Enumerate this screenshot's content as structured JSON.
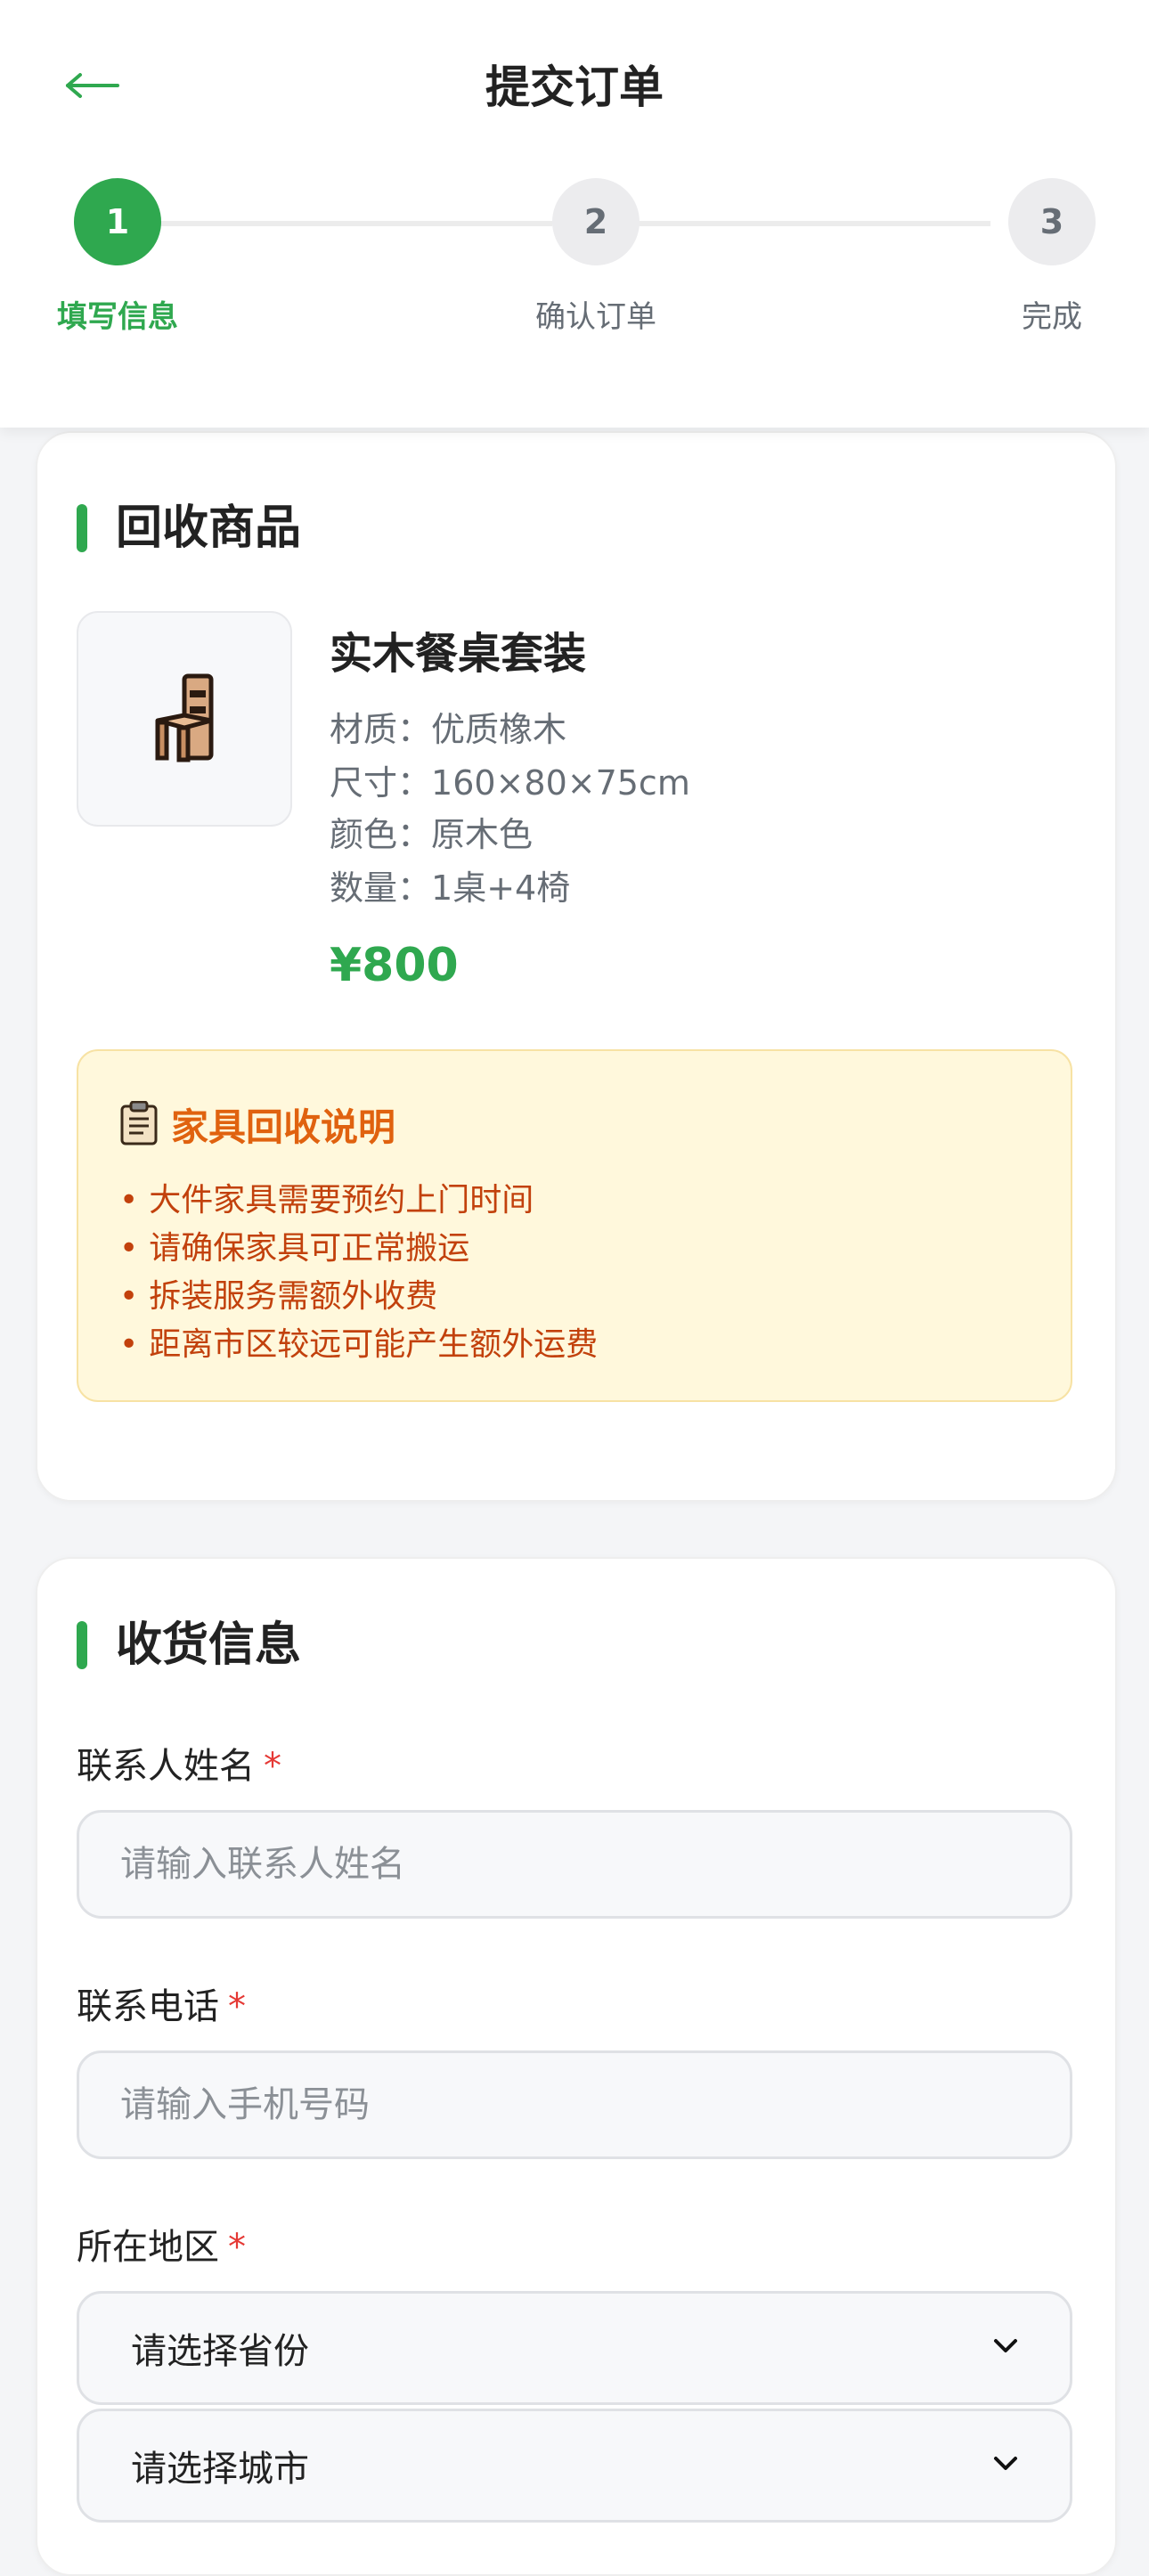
{
  "header": {
    "title": "提交订单",
    "back_icon": "arrow-left-icon",
    "accent": "#2fa84f"
  },
  "steps": [
    {
      "number": "1",
      "label": "填写信息",
      "state": "active"
    },
    {
      "number": "2",
      "label": "确认订单",
      "state": "pending"
    },
    {
      "number": "3",
      "label": "完成",
      "state": "pending"
    }
  ],
  "product_section": {
    "title": "回收商品",
    "product": {
      "icon": "chair-icon",
      "name": "实木餐桌套装",
      "specs": [
        {
          "key": "材质：",
          "value": "优质橡木"
        },
        {
          "key": "尺寸：",
          "value": "160×80×75cm"
        },
        {
          "key": "颜色：",
          "value": "原木色"
        },
        {
          "key": "数量：",
          "value": "1桌+4椅"
        }
      ],
      "price": "¥800"
    },
    "notice": {
      "icon": "clipboard-icon",
      "title": "家具回收说明",
      "items": [
        "大件家具需要预约上门时间",
        "请确保家具可正常搬运",
        "拆装服务需额外收费",
        "距离市区较远可能产生额外运费"
      ],
      "bullet": "•"
    }
  },
  "shipping_section": {
    "title": "收货信息",
    "required_mark": "*",
    "name_field": {
      "label": "联系人姓名",
      "placeholder": "请输入联系人姓名",
      "value": ""
    },
    "phone_field": {
      "label": "联系电话",
      "placeholder": "请输入手机号码",
      "value": ""
    },
    "region_field": {
      "label": "所在地区",
      "province_select": "请选择省份",
      "city_select": "请选择城市"
    }
  }
}
